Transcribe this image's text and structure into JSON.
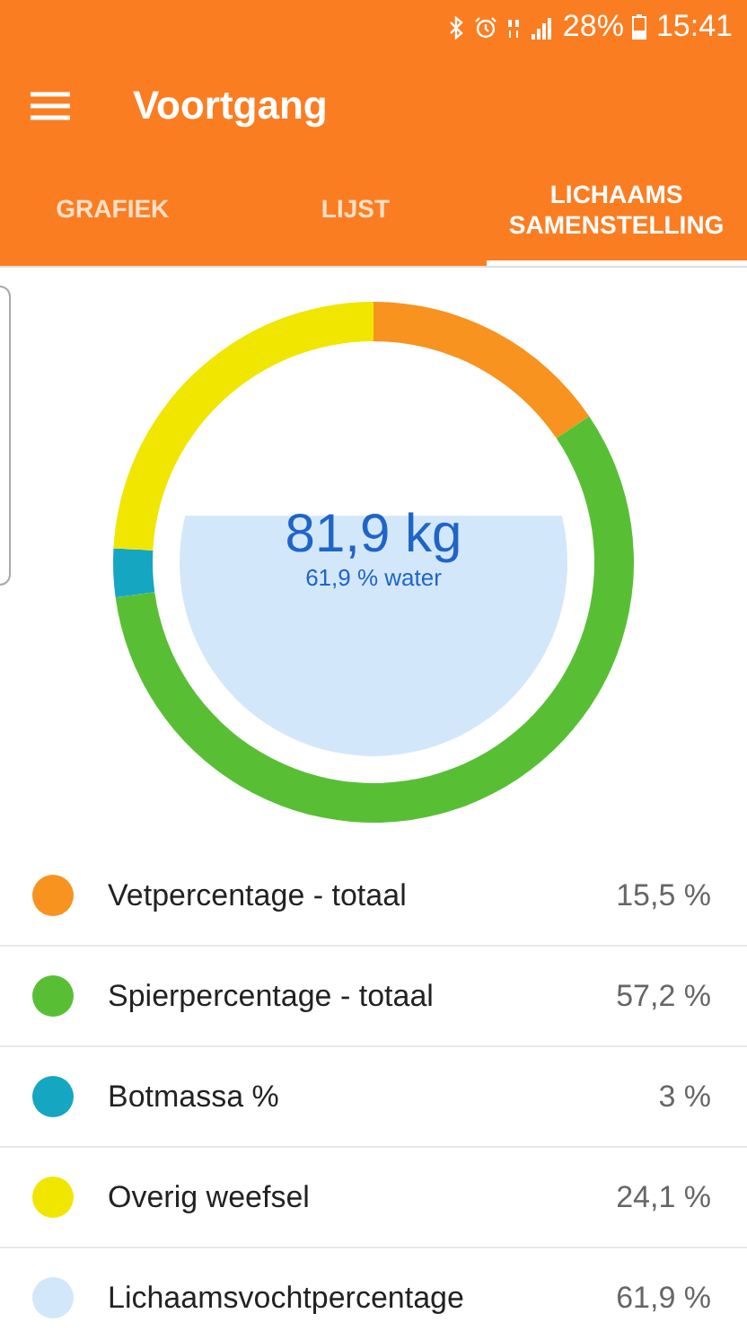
{
  "status_bar": {
    "battery": "28%",
    "time": "15:41"
  },
  "toolbar": {
    "title": "Voortgang"
  },
  "tabs": [
    {
      "label": "GRAFIEK",
      "selected": false
    },
    {
      "label": "LIJST",
      "selected": false
    },
    {
      "label": "LICHAAMS SAMENSTELLING",
      "selected": true
    }
  ],
  "composition": {
    "weight": "81,9 kg",
    "water": "61,9 % water",
    "chart_data": {
      "type": "donut",
      "series": [
        {
          "values": [
            15.5,
            57.2,
            3,
            24.1
          ]
        }
      ]
    }
  },
  "legend": [
    {
      "label": "Vetpercentage - totaal",
      "value": "15,5 %",
      "color": "#f7931e"
    },
    {
      "label": "Spierpercentage - totaal",
      "value": "57,2 %",
      "color": "#58bf35"
    },
    {
      "label": "Botmassa %",
      "value": "3 %",
      "color": "#15a6c2"
    },
    {
      "label": "Overig weefsel",
      "value": "24,1 %",
      "color": "#f1e600"
    },
    {
      "label": "Lichaamsvochtpercentage",
      "value": "61,9 %",
      "color": "#d3e7fa"
    }
  ]
}
